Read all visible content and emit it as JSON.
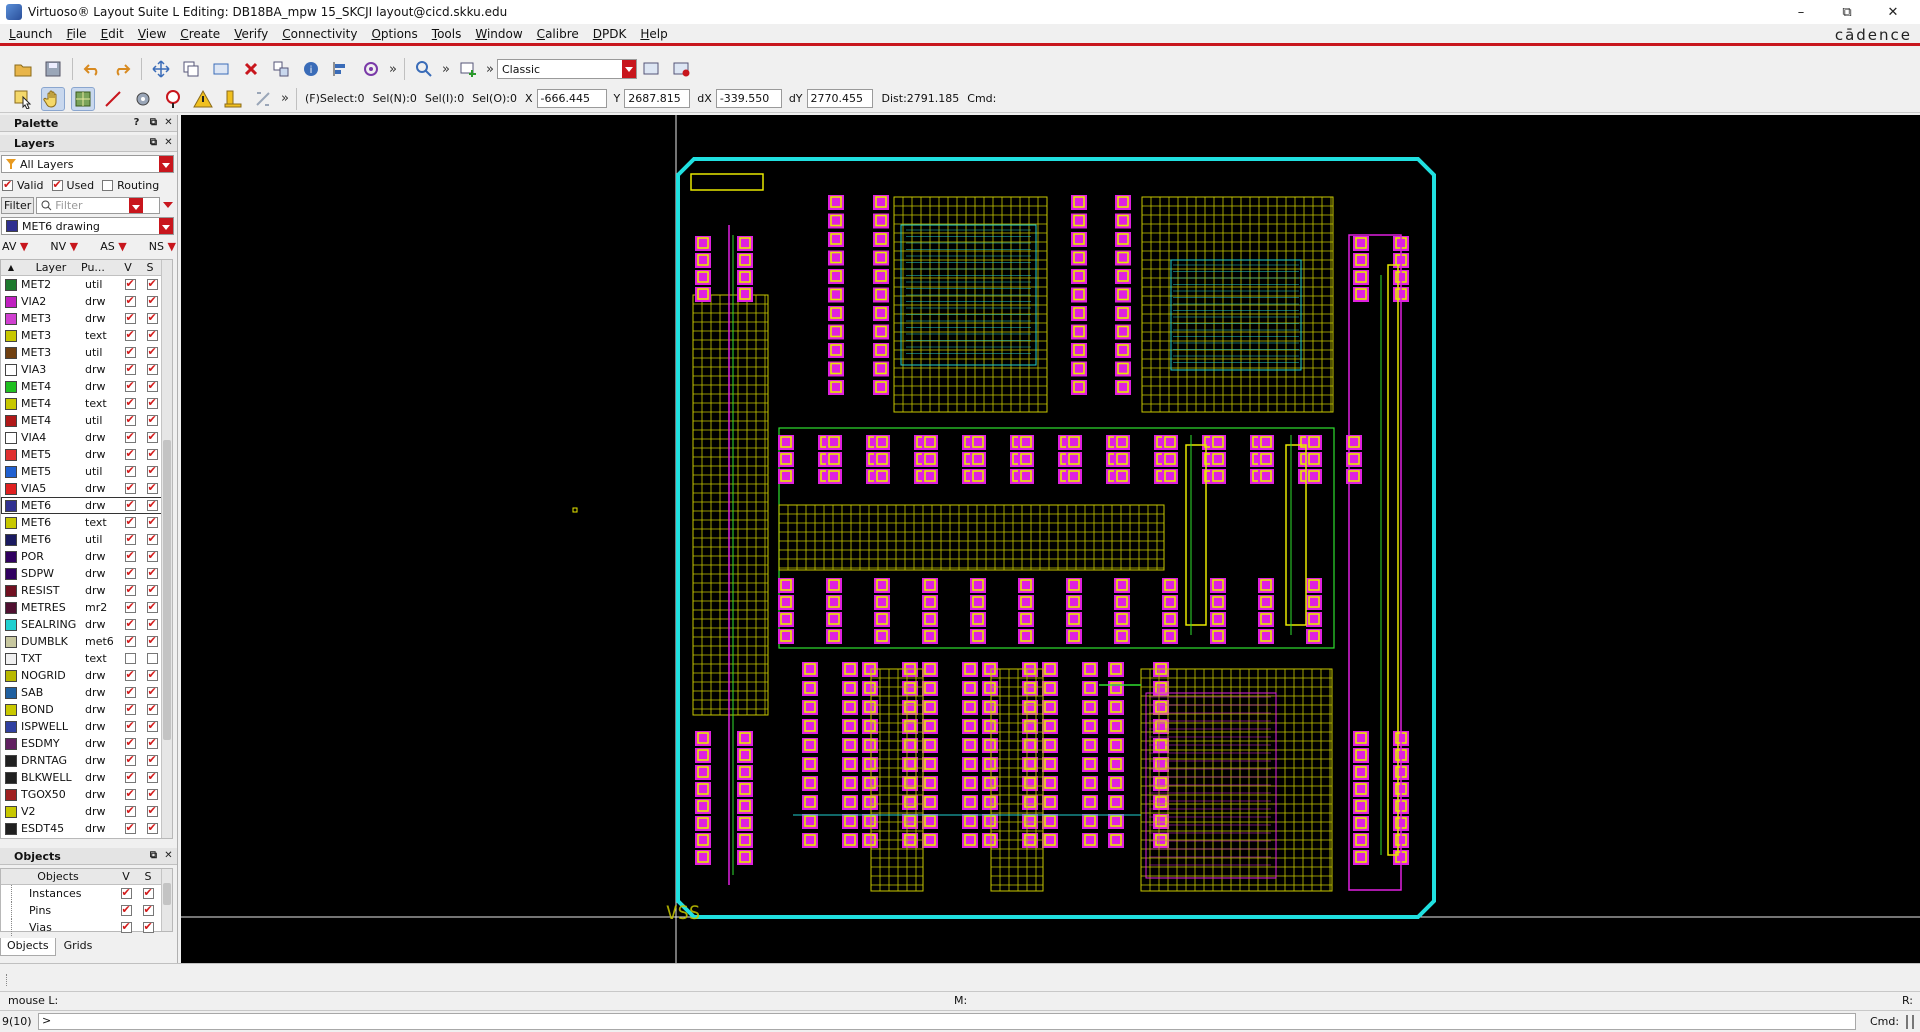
{
  "window": {
    "title": "Virtuoso® Layout Suite L Editing: DB18BA_mpw 15_SKCJI layout@cicd.skku.edu",
    "controls": [
      "–",
      "⧉",
      "✕"
    ]
  },
  "menu": {
    "items": [
      "Launch",
      "File",
      "Edit",
      "View",
      "Create",
      "Verify",
      "Connectivity",
      "Options",
      "Tools",
      "Window",
      "Calibre",
      "DPDK",
      "Help"
    ],
    "brand": "cādence"
  },
  "toolbar": {
    "workspace": "Classic",
    "more": "»"
  },
  "status": {
    "fselect": "(F)Select:0",
    "seln": "Sel(N):0",
    "seli": "Sel(I):0",
    "selo": "Sel(O):0",
    "x_label": "X",
    "x_value": "-666.445",
    "y_label": "Y",
    "y_value": "2687.815",
    "dx_label": "dX",
    "dx_value": "-339.550",
    "dy_label": "dY",
    "dy_value": "2770.455",
    "dist": "Dist:2791.185",
    "cmd": "Cmd:"
  },
  "palette": {
    "title": "Palette",
    "layers_title": "Layers",
    "filter_all": "All Layers",
    "valid": "Valid",
    "used": "Used",
    "routing": "Routing",
    "filter_label": "Filter",
    "filter_placeholder": "Filter",
    "current_layer": "MET6 drawing",
    "vis_buttons": [
      "AV",
      "NV",
      "AS",
      "NS"
    ],
    "col_layer": "Layer",
    "col_purpose": "Pu...",
    "col_v": "V",
    "col_s": "S",
    "layers": [
      {
        "name": "MET2",
        "purpose": "util",
        "color": "#1e7a2e",
        "v": true,
        "s": true
      },
      {
        "name": "VIA2",
        "purpose": "drw",
        "color": "#c020c0",
        "v": true,
        "s": true
      },
      {
        "name": "MET3",
        "purpose": "drw",
        "color": "#d040d0",
        "v": true,
        "s": true
      },
      {
        "name": "MET3",
        "purpose": "text",
        "color": "#c8c800",
        "v": true,
        "s": true
      },
      {
        "name": "MET3",
        "purpose": "util",
        "color": "#704010",
        "v": true,
        "s": true
      },
      {
        "name": "VIA3",
        "purpose": "drw",
        "color": "#ffffff",
        "v": true,
        "s": true
      },
      {
        "name": "MET4",
        "purpose": "drw",
        "color": "#20c020",
        "v": true,
        "s": true
      },
      {
        "name": "MET4",
        "purpose": "text",
        "color": "#c8c800",
        "v": true,
        "s": true
      },
      {
        "name": "MET4",
        "purpose": "util",
        "color": "#b01818",
        "v": true,
        "s": true
      },
      {
        "name": "VIA4",
        "purpose": "drw",
        "color": "#ffffff",
        "v": true,
        "s": true
      },
      {
        "name": "MET5",
        "purpose": "drw",
        "color": "#e03030",
        "v": true,
        "s": true
      },
      {
        "name": "MET5",
        "purpose": "util",
        "color": "#2060d0",
        "v": true,
        "s": true
      },
      {
        "name": "VIA5",
        "purpose": "drw",
        "color": "#e02020",
        "v": true,
        "s": true
      },
      {
        "name": "MET6",
        "purpose": "drw",
        "color": "#303090",
        "v": true,
        "s": true
      },
      {
        "name": "MET6",
        "purpose": "text",
        "color": "#c8c800",
        "v": true,
        "s": true
      },
      {
        "name": "MET6",
        "purpose": "util",
        "color": "#1a1a60",
        "v": true,
        "s": true
      },
      {
        "name": "POR",
        "purpose": "drw",
        "color": "#300060",
        "v": true,
        "s": true
      },
      {
        "name": "SDPW",
        "purpose": "drw",
        "color": "#300060",
        "v": true,
        "s": true
      },
      {
        "name": "RESIST",
        "purpose": "drw",
        "color": "#701020",
        "v": true,
        "s": true
      },
      {
        "name": "METRES",
        "purpose": "mr2",
        "color": "#501030",
        "v": true,
        "s": true
      },
      {
        "name": "SEALRING",
        "purpose": "drw",
        "color": "#20d0d0",
        "v": true,
        "s": true
      },
      {
        "name": "DUMBLK",
        "purpose": "met6",
        "color": "#c8c8a0",
        "v": true,
        "s": true
      },
      {
        "name": "TXT",
        "purpose": "text",
        "color": "#f0f0f0",
        "v": false,
        "s": false
      },
      {
        "name": "NOGRID",
        "purpose": "drw",
        "color": "#b8b800",
        "v": true,
        "s": true
      },
      {
        "name": "SAB",
        "purpose": "drw",
        "color": "#2060a0",
        "v": true,
        "s": true
      },
      {
        "name": "BOND",
        "purpose": "drw",
        "color": "#c8c800",
        "v": true,
        "s": true
      },
      {
        "name": "ISPWELL",
        "purpose": "drw",
        "color": "#3040a0",
        "v": true,
        "s": true
      },
      {
        "name": "ESDMY",
        "purpose": "drw",
        "color": "#602060",
        "v": true,
        "s": true
      },
      {
        "name": "DRNTAG",
        "purpose": "drw",
        "color": "#202020",
        "v": true,
        "s": true
      },
      {
        "name": "BLKWELL",
        "purpose": "drw",
        "color": "#202020",
        "v": true,
        "s": true
      },
      {
        "name": "TGOX50",
        "purpose": "drw",
        "color": "#a02020",
        "v": true,
        "s": true
      },
      {
        "name": "V2",
        "purpose": "drw",
        "color": "#c8c800",
        "v": true,
        "s": true
      },
      {
        "name": "ESDT45",
        "purpose": "drw",
        "color": "#202020",
        "v": true,
        "s": true
      }
    ],
    "selected_layer_index": 13
  },
  "objects": {
    "title": "Objects",
    "col_objects": "Objects",
    "col_v": "V",
    "col_s": "S",
    "items": [
      {
        "name": "Instances",
        "v": true,
        "s": true
      },
      {
        "name": "Pins",
        "v": true,
        "s": true
      },
      {
        "name": "Vias",
        "v": true,
        "s": true
      }
    ],
    "tabs": [
      "Objects",
      "Grids"
    ]
  },
  "canvas": {
    "label": "VSS",
    "colors": {
      "sealring": "#20e0e0",
      "metal_magenta": "#e020e0",
      "pad_yellow": "#e8e800",
      "route_cyan": "#20d0d0",
      "route_green": "#30e030",
      "grid_yellow": "#c8c800"
    }
  },
  "bottom": {
    "mouse_l": "mouse L:",
    "mouse_m": "M:",
    "mouse_r": "R:",
    "cmd_index": "9(10)",
    "prompt": ">",
    "cmd_label": "Cmd:"
  }
}
